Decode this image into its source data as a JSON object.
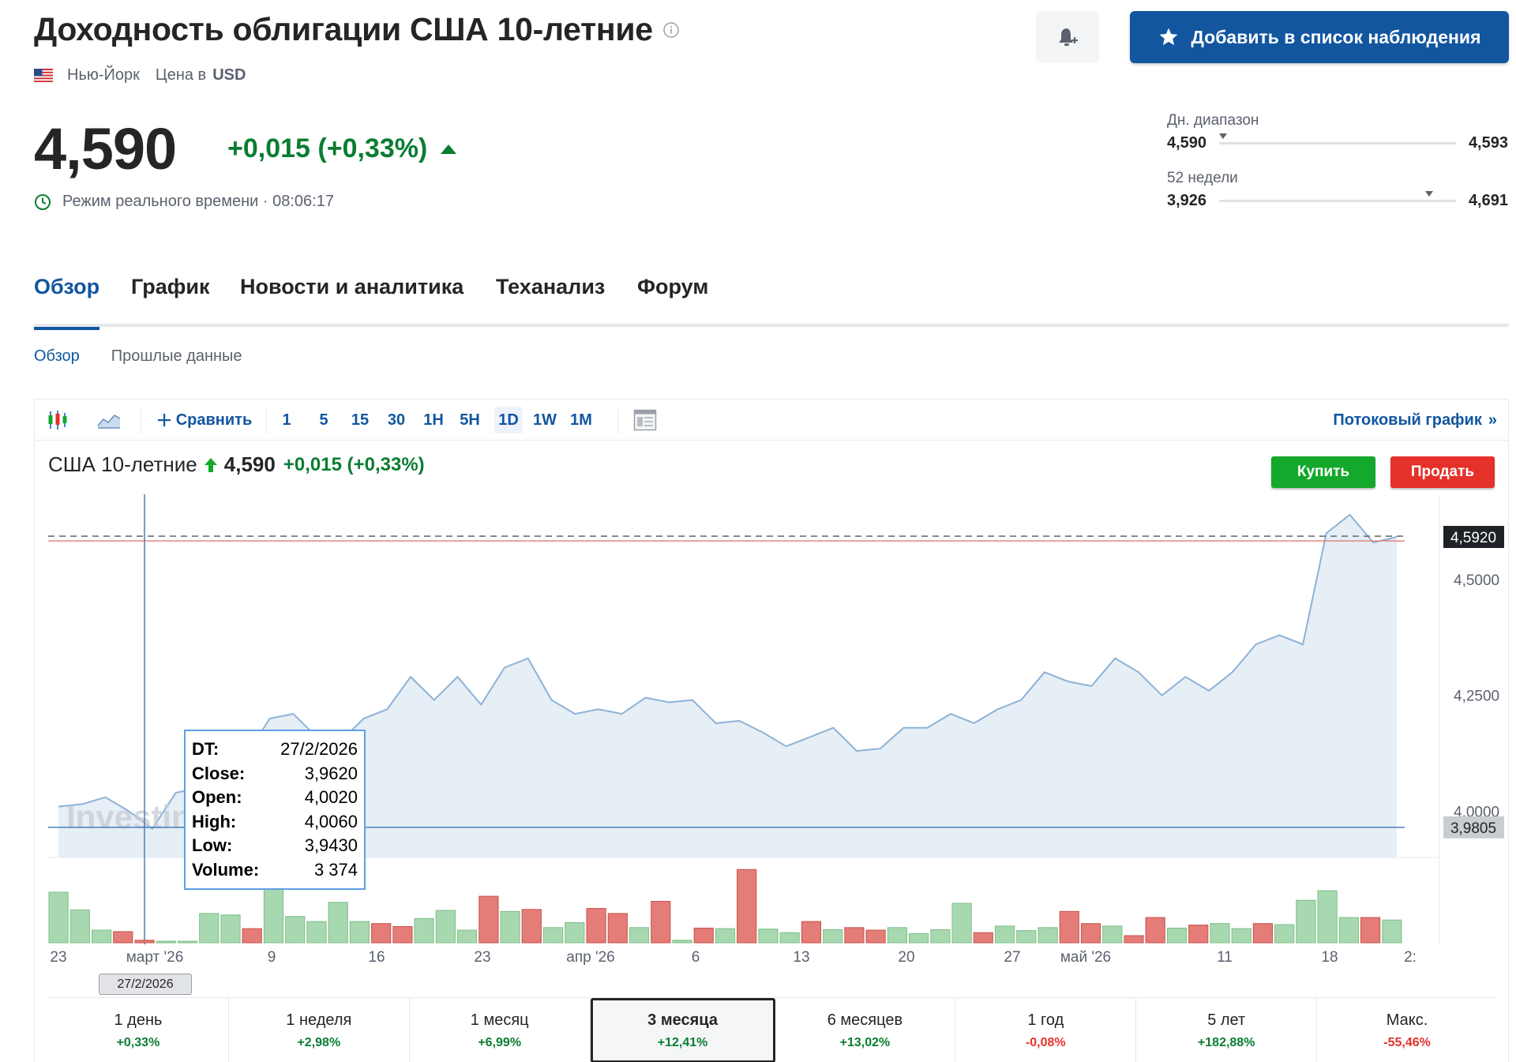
{
  "header": {
    "title": "Доходность облигации США 10-летние",
    "location": "Нью-Йорк",
    "price_in_label": "Цена в",
    "currency": "USD",
    "watchlist_button": "Добавить в список наблюдения"
  },
  "quote": {
    "price": "4,590",
    "change": "+0,015 (+0,33%)",
    "realtime": "Режим реального времени · 08:06:17"
  },
  "ranges": {
    "day": {
      "label": "Дн. диапазон",
      "low": "4,590",
      "high": "4,593",
      "position": 0.0
    },
    "year": {
      "label": "52 недели",
      "low": "3,926",
      "high": "4,691",
      "position": 0.87
    }
  },
  "tabs": [
    {
      "label": "Обзор",
      "active": true
    },
    {
      "label": "График",
      "active": false
    },
    {
      "label": "Новости и аналитика",
      "active": false
    },
    {
      "label": "Теханализ",
      "active": false
    },
    {
      "label": "Форум",
      "active": false
    }
  ],
  "subtabs": [
    {
      "label": "Обзор",
      "active": true
    },
    {
      "label": "Прошлые данные",
      "active": false
    }
  ],
  "toolbar": {
    "compare": "Сравнить",
    "intervals": [
      "1",
      "5",
      "15",
      "30",
      "1H",
      "5H",
      "1D",
      "1W",
      "1M"
    ],
    "selected_interval": "1D",
    "stream": "Потоковый график"
  },
  "legend": {
    "name": "США 10-летние",
    "value": "4,590",
    "change": "+0,015 (+0,33%)"
  },
  "trade": {
    "buy": "Купить",
    "sell": "Продать"
  },
  "tooltip": {
    "rows": [
      {
        "k": "DT:",
        "v": "27/2/2026"
      },
      {
        "k": "Close:",
        "v": "3,9620"
      },
      {
        "k": "Open:",
        "v": "4,0020"
      },
      {
        "k": "High:",
        "v": "4,0060"
      },
      {
        "k": "Low:",
        "v": "3,9430"
      },
      {
        "k": "Volume:",
        "v": "3 374"
      }
    ]
  },
  "crosshair_date": "27/2/2026",
  "watermark": "Investin",
  "periods": [
    {
      "label": "1 день",
      "value": "+0,33%",
      "sign": "pos",
      "active": false
    },
    {
      "label": "1 неделя",
      "value": "+2,98%",
      "sign": "pos",
      "active": false
    },
    {
      "label": "1 месяц",
      "value": "+6,99%",
      "sign": "pos",
      "active": false
    },
    {
      "label": "3 месяца",
      "value": "+12,41%",
      "sign": "pos",
      "active": true
    },
    {
      "label": "6 месяцев",
      "value": "+13,02%",
      "sign": "pos",
      "active": false
    },
    {
      "label": "1 год",
      "value": "-0,08%",
      "sign": "neg",
      "active": false
    },
    {
      "label": "5 лет",
      "value": "+182,88%",
      "sign": "pos",
      "active": false
    },
    {
      "label": "Макс.",
      "value": "-55,46%",
      "sign": "neg",
      "active": false
    }
  ],
  "chart_data": {
    "type": "area",
    "y_axis_labels": [
      "4,5000",
      "4,2500",
      "4,0000"
    ],
    "ylim": [
      3.9,
      4.65
    ],
    "last_price_label": "4,5920",
    "last_price": 4.592,
    "crosshair_price_label": "3,9805",
    "crosshair_price": 3.9805,
    "x_tick_labels": [
      "23",
      "март '26",
      "9",
      "16",
      "23",
      "апр '26",
      "6",
      "13",
      "20",
      "27",
      "май '26",
      "11",
      "18",
      "2:"
    ],
    "closes": [
      4.01,
      4.015,
      4.03,
      4.0,
      3.962,
      4.04,
      4.05,
      4.1,
      4.12,
      4.2,
      4.21,
      4.16,
      4.15,
      4.2,
      4.22,
      4.29,
      4.24,
      4.29,
      4.23,
      4.31,
      4.33,
      4.24,
      4.21,
      4.22,
      4.21,
      4.245,
      4.235,
      4.24,
      4.19,
      4.195,
      4.17,
      4.14,
      4.16,
      4.18,
      4.13,
      4.135,
      4.18,
      4.18,
      4.21,
      4.19,
      4.22,
      4.24,
      4.3,
      4.28,
      4.27,
      4.33,
      4.3,
      4.25,
      4.29,
      4.26,
      4.3,
      4.36,
      4.38,
      4.36,
      4.6,
      4.64,
      4.58,
      4.592
    ],
    "volumes": [
      1.0,
      0.65,
      0.25,
      0.22,
      0.05,
      0.02,
      0.01,
      0.58,
      0.55,
      0.28,
      1.15,
      0.52,
      0.42,
      0.8,
      0.42,
      0.38,
      0.32,
      0.48,
      0.64,
      0.25,
      0.92,
      0.62,
      0.66,
      0.3,
      0.4,
      0.68,
      0.58,
      0.3,
      0.82,
      0.05,
      0.29,
      0.28,
      1.45,
      0.27,
      0.2,
      0.42,
      0.26,
      0.3,
      0.25,
      0.3,
      0.18,
      0.26,
      0.78,
      0.2,
      0.33,
      0.24,
      0.3,
      0.62,
      0.38,
      0.33,
      0.14,
      0.5,
      0.29,
      0.35,
      0.38,
      0.28,
      0.38,
      0.36,
      0.84,
      1.03,
      0.5,
      0.5,
      0.45
    ],
    "volume_direction": [
      "up",
      "up",
      "up",
      "down",
      "down",
      "up",
      "up",
      "up",
      "up",
      "down",
      "up",
      "up",
      "up",
      "up",
      "up",
      "down",
      "down",
      "up",
      "up",
      "up",
      "down",
      "up",
      "down",
      "up",
      "up",
      "down",
      "down",
      "up",
      "down",
      "up",
      "down",
      "up",
      "down",
      "up",
      "up",
      "down",
      "up",
      "down",
      "down",
      "up",
      "up",
      "up",
      "up",
      "down",
      "up",
      "up",
      "up",
      "down",
      "down",
      "up",
      "down",
      "down",
      "up",
      "down",
      "up",
      "up",
      "down",
      "up",
      "up",
      "up",
      "up",
      "down",
      "up"
    ]
  }
}
